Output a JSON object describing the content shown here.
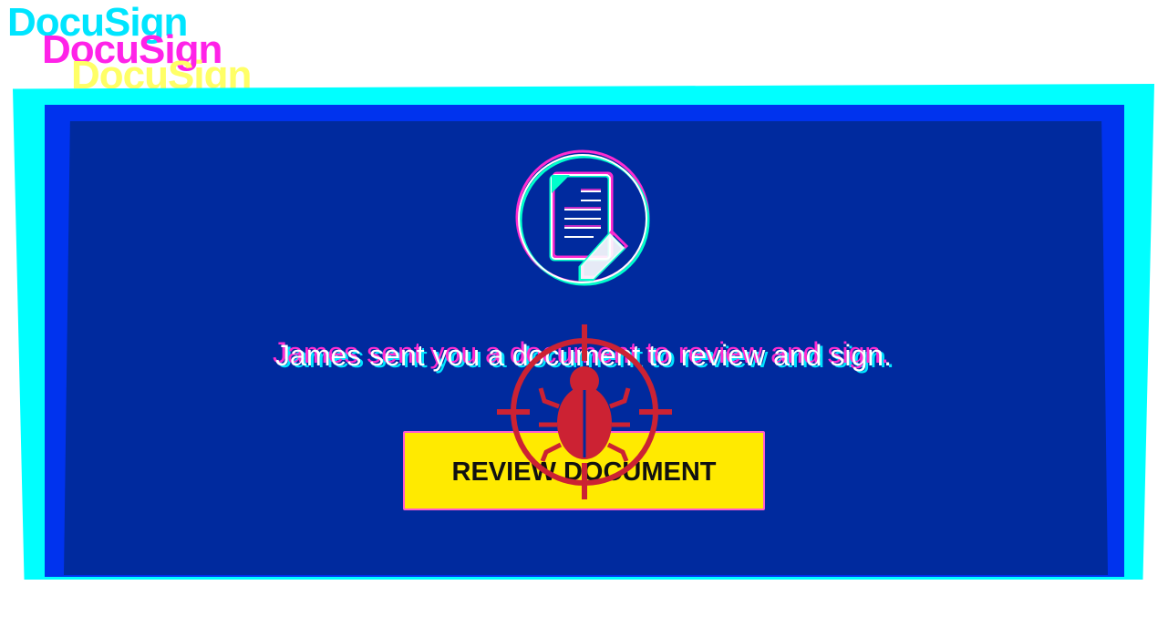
{
  "brand": {
    "logo_text": "DocuSign",
    "colors": {
      "cyan": "#00ffff",
      "magenta": "#ff22e8",
      "yellow": "#ffea00",
      "blue_frame": "#0033ee",
      "card": "#002a9e"
    }
  },
  "main": {
    "message": "James sent you a document to review and sign.",
    "review_button_label": "REVIEW DOCUMENT",
    "icon": "document-sign-icon"
  },
  "overlay": {
    "icon": "bug-target-icon",
    "color": "#cc2233"
  }
}
